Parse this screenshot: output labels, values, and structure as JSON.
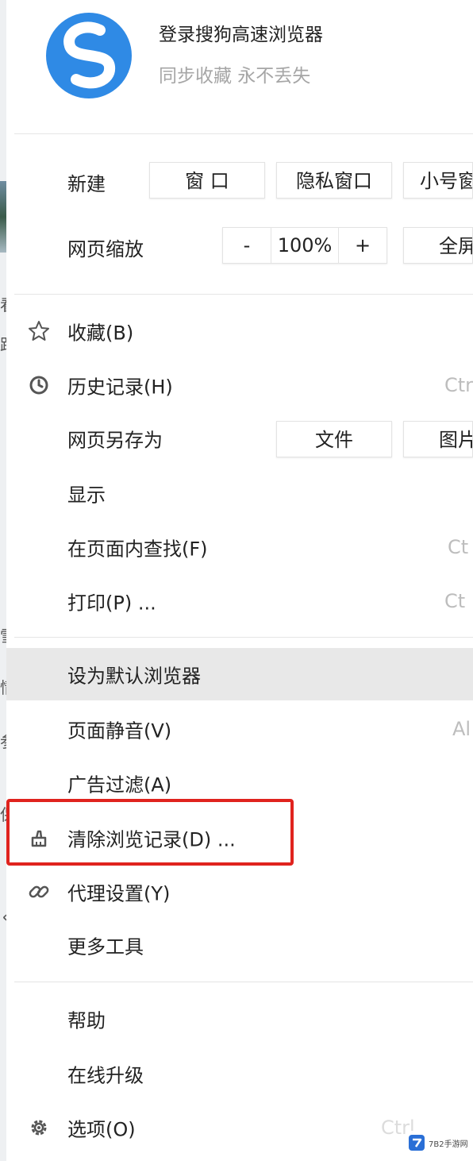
{
  "background": {
    "fragments": [
      "看",
      "路",
      "雪",
      "情",
      "参",
      "保",
      "く"
    ]
  },
  "header": {
    "title": "登录搜狗高速浏览器",
    "subtitle": "同步收藏 永不丢失",
    "logo_icon": "sogou-logo-icon",
    "brand_color": "#2f8ae5"
  },
  "new_row": {
    "label": "新建",
    "window_btn": "窗 口",
    "private_btn": "隐私窗口",
    "small_btn": "小号窗"
  },
  "zoom_row": {
    "label": "网页缩放",
    "minus": "-",
    "value": "100%",
    "plus": "+",
    "fullscreen": "全屏"
  },
  "menu": {
    "favorites": {
      "label": "收藏(B)",
      "icon": "star-icon"
    },
    "history": {
      "label": "历史记录(H)",
      "shortcut": "Ctr",
      "icon": "clock-icon"
    },
    "save_as": {
      "label": "网页另存为",
      "file_btn": "文件",
      "image_btn": "图片"
    },
    "display": {
      "label": "显示"
    },
    "find": {
      "label": "在页面内查找(F)",
      "shortcut": "Ct"
    },
    "print": {
      "label": "打印(P) ...",
      "shortcut": "Ct"
    },
    "default_browser": {
      "label": "设为默认浏览器"
    },
    "mute": {
      "label": "页面静音(V)",
      "shortcut": "Al"
    },
    "ad_filter": {
      "label": "广告过滤(A)"
    },
    "clear_history": {
      "label": "清除浏览记录(D) ...",
      "icon": "broom-icon"
    },
    "proxy": {
      "label": "代理设置(Y)",
      "icon": "link-icon"
    },
    "more_tools": {
      "label": "更多工具"
    },
    "help": {
      "label": "帮助"
    },
    "upgrade": {
      "label": "在线升级"
    },
    "options": {
      "label": "选项(O)",
      "shortcut": "Ctrl",
      "icon": "gear-icon"
    }
  },
  "highlight_color": "#e0231e",
  "watermark": {
    "text": "7B2手游网"
  }
}
